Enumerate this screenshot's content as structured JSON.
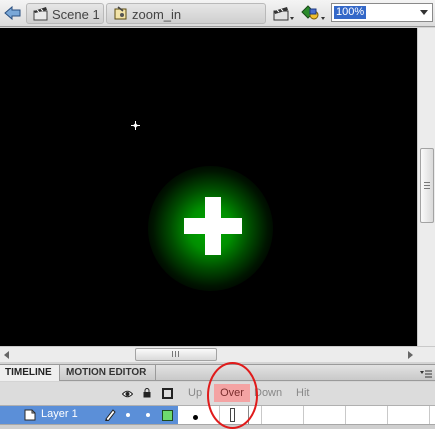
{
  "editbar": {
    "scene_label": "Scene 1",
    "symbol_label": "zoom_in",
    "zoom_value": "100%"
  },
  "icons": {
    "back": "back-arrow-icon",
    "scene": "clapperboard-icon",
    "symbol": "button-symbol-icon",
    "edit_scene": "edit-scene-icon",
    "edit_symbol": "edit-symbols-icon",
    "stage_symbol": "plus-icon",
    "registration": "crosshair-icon",
    "visibility": "eye-icon",
    "lock": "lock-icon",
    "outline": "outline-icon",
    "layer": "layer-icon",
    "edit_layer": "pencil-icon",
    "panel_menu": "panel-menu-icon"
  },
  "colors": {
    "stage_bg": "#000000",
    "plus_color": "#ffffff",
    "glow_color": "#00aa00",
    "layer_highlight": "#5b8fd8",
    "over_frame_bg": "#f4a3a3",
    "annotation_ring": "#e01b1b"
  },
  "panel": {
    "tabs": [
      {
        "label": "TIMELINE"
      },
      {
        "label": "MOTION EDITOR"
      }
    ]
  },
  "timeline": {
    "frame_labels": [
      "Up",
      "Over",
      "Down",
      "Hit"
    ],
    "layer_name": "Layer 1"
  }
}
